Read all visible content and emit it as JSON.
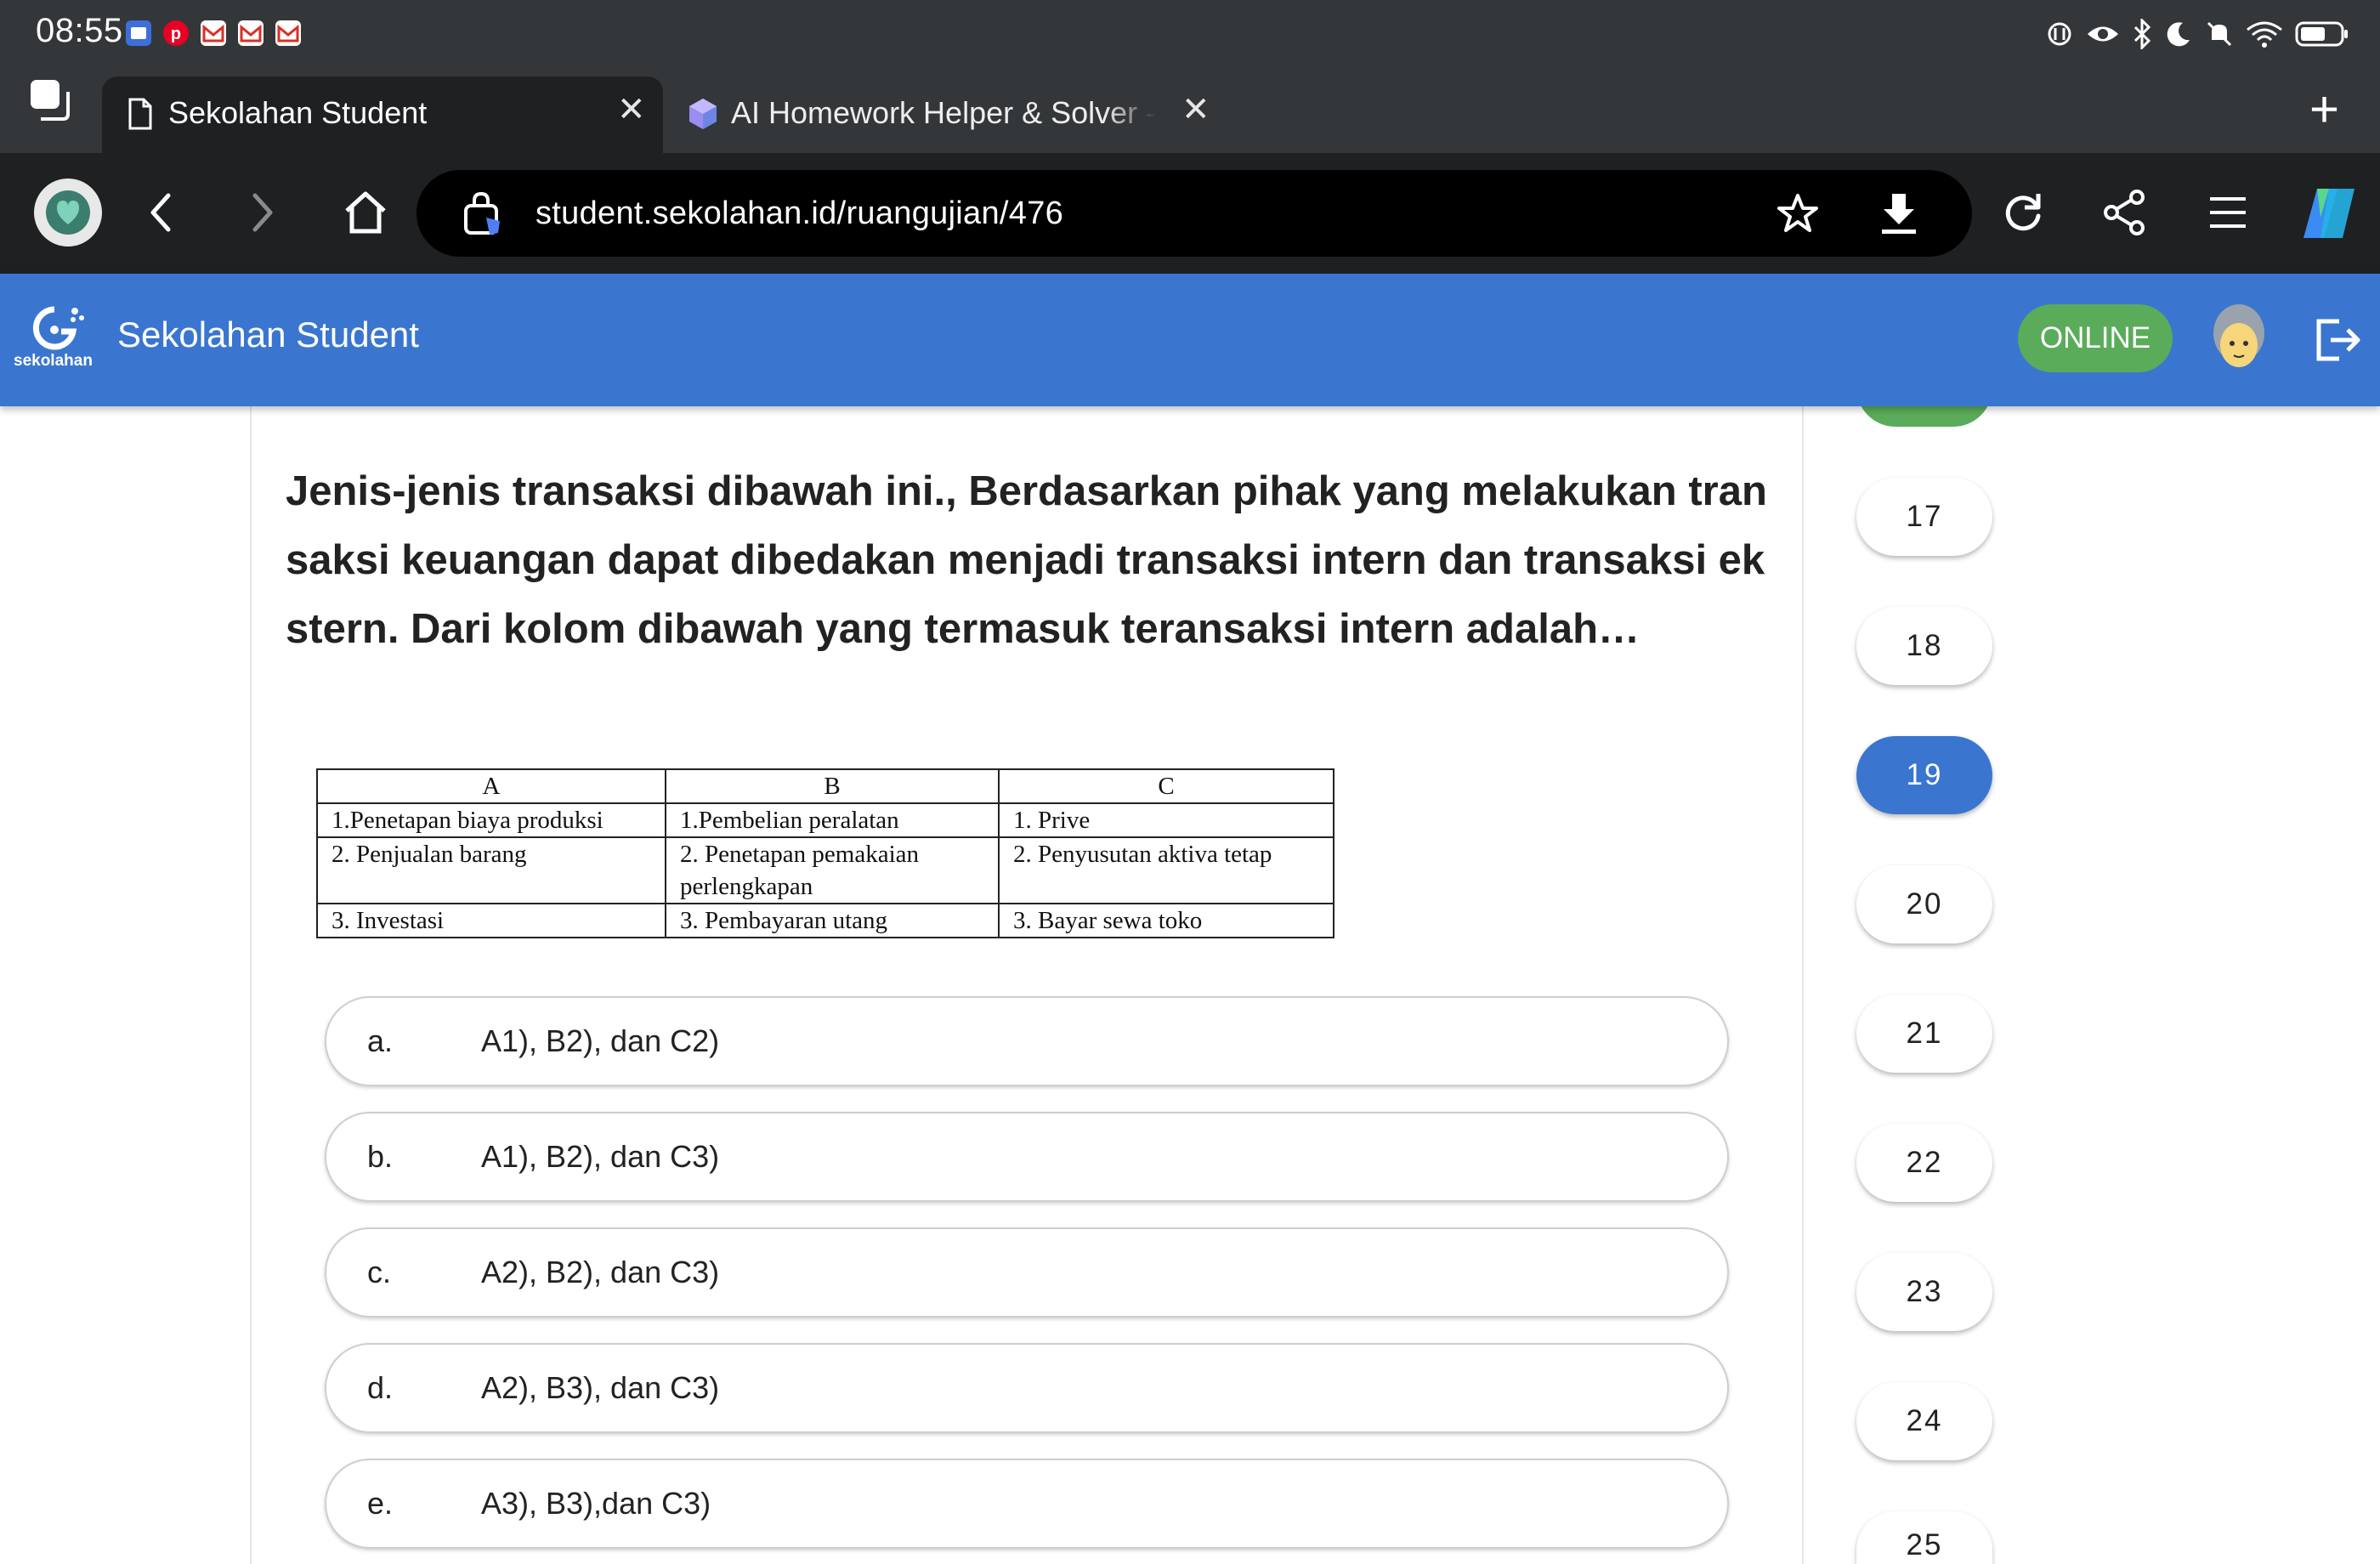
{
  "status_bar": {
    "time": "08:55",
    "notification_icons": [
      "messages-icon",
      "pinterest-icon",
      "gmail-icon",
      "gmail-icon",
      "gmail-icon"
    ],
    "indicator_icons": [
      "nfc-icon",
      "eye-icon",
      "bluetooth-icon",
      "moon-icon",
      "mute-icon",
      "wifi-icon",
      "battery-icon"
    ]
  },
  "tabs": [
    {
      "title": "Sekolahan Student",
      "icon": "document-icon",
      "active": true
    },
    {
      "title": "AI Homework Helper & Solver - S",
      "icon": "cube-icon",
      "active": false
    }
  ],
  "toolbar": {
    "url": "student.sekolahan.id/ruangujian/476"
  },
  "app": {
    "logo_text": "sekolahan",
    "title": "Sekolahan Student",
    "status": "ONLINE"
  },
  "question": {
    "text": "Jenis-jenis transaksi dibawah ini., Berdasarkan pihak yang melakukan tran saksi keuangan dapat dibedakan menjadi transaksi intern dan transaksi ek stern. Dari kolom dibawah yang termasuk teransaksi intern adalah…",
    "lines": [
      "Jenis-jenis transaksi dibawah ini., Berdasarkan pihak yang melakukan tran",
      "saksi keuangan dapat dibedakan menjadi transaksi intern dan transaksi ek",
      "stern. Dari kolom dibawah yang termasuk teransaksi intern adalah…"
    ],
    "table": {
      "headers": [
        "A",
        "B",
        "C"
      ],
      "rows": [
        [
          "1.Penetapan biaya produksi",
          "1.Pembelian peralatan",
          "1. Prive"
        ],
        [
          "2. Penjualan barang",
          "2. Penetapan pemakaian perlengkapan",
          "2. Penyusutan aktiva tetap"
        ],
        [
          "3. Investasi",
          "3. Pembayaran utang",
          "3. Bayar sewa toko"
        ]
      ]
    },
    "options": [
      {
        "letter": "a.",
        "text": "A1), B2), dan C2)"
      },
      {
        "letter": "b.",
        "text": "A1), B2), dan C3)"
      },
      {
        "letter": "c.",
        "text": "A2), B2), dan C3)"
      },
      {
        "letter": "d.",
        "text": "A2), B3), dan C3)"
      },
      {
        "letter": "e.",
        "text": "A3), B3),dan C3)"
      }
    ]
  },
  "question_nav": {
    "numbers": [
      "17",
      "18",
      "19",
      "20",
      "21",
      "22",
      "23",
      "24",
      "25"
    ],
    "active": "19"
  }
}
